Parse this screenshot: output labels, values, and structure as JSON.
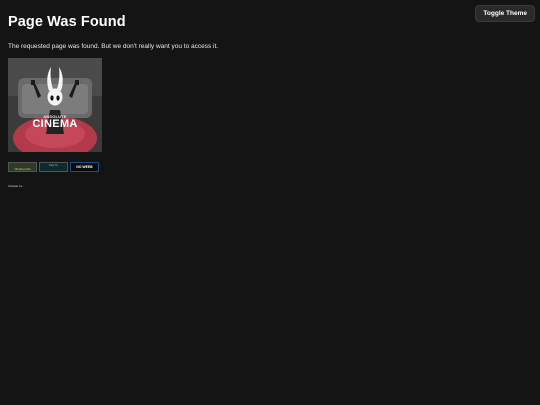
{
  "header": {
    "toggle_label": "Toggle Theme"
  },
  "main": {
    "title": "Page Was Found",
    "description": "The requested page was found. But we don't really want you to access it.",
    "image": {
      "caption_top": "ABSOLUTE",
      "caption_bottom": "CINEMA"
    },
    "badges": [
      {
        "icon": "badge-1-icon",
        "line1": "",
        "line2": "Vibrating bells"
      },
      {
        "icon": "badge-2-icon",
        "line1": "Dark fm",
        "line2": ""
      },
      {
        "icon": "badge-3-icon",
        "line1": "",
        "line2": "NO WEEB"
      }
    ],
    "footnote": "Gravatar me"
  },
  "colors": {
    "background": "#141414",
    "text": "#f0f0f0",
    "button_bg": "#2a2a2a"
  }
}
